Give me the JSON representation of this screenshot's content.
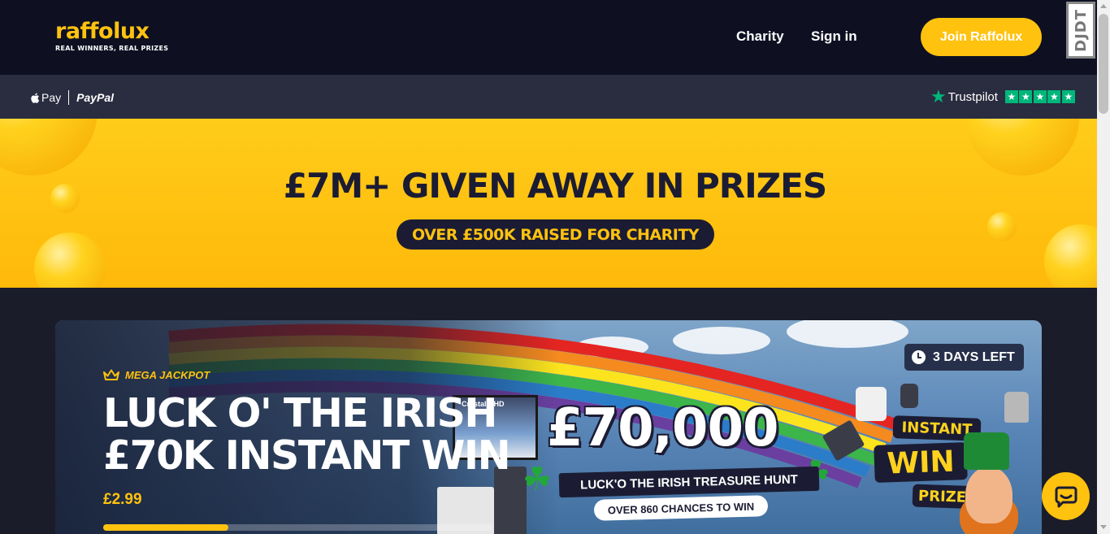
{
  "header": {
    "logo_word": "raffolux",
    "logo_tagline": "REAL WINNERS, REAL PRIZES",
    "nav": {
      "charity": "Charity",
      "sign_in": "Sign in"
    },
    "join_label": "Join Raffolux",
    "debug_toolbar_label": "DJDT"
  },
  "payments": {
    "apple_pay": "Pay",
    "paypal": "PayPal",
    "trustpilot": "Trustpilot",
    "trustpilot_stars": 5
  },
  "banner": {
    "title": "£7M+ GIVEN AWAY IN PRIZES",
    "pill": "OVER £500K RAISED FOR CHARITY"
  },
  "featured": {
    "days_left": "3 DAYS LEFT",
    "badge": "MEGA JACKPOT",
    "title_line1": "LUCK O' THE IRISH",
    "title_line2": "£70K INSTANT WIN",
    "price": "£2.99",
    "progress_fraction": 0.32,
    "art": {
      "amount": "£70,000",
      "hunt": "LUCK'O THE IRISH TREASURE HUNT",
      "chances": "OVER 860 CHANCES TO WIN",
      "instant": "INSTANT",
      "win": "WIN",
      "prizes": "PRIZES",
      "tv_label": "Crystal UHD"
    }
  },
  "colors": {
    "brand_yellow": "#ffc20f",
    "navy": "#0e1022",
    "trustpilot_green": "#00b67a"
  }
}
